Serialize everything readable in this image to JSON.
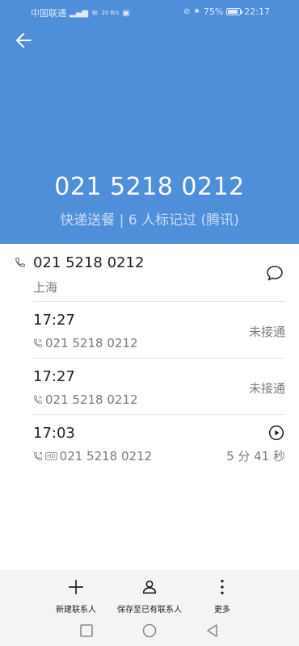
{
  "status_bar": {
    "carrier": "中国联通",
    "net_speed": "20 B/s",
    "battery": "75%",
    "time": "22:17"
  },
  "header": {
    "phone_number": "021 5218 0212",
    "tag_line": "快递送餐 | 6 人标记过 (腾讯)"
  },
  "contact": {
    "number": "021 5218 0212",
    "location": "上海"
  },
  "call_log": [
    {
      "time": "17:27",
      "number": "021 5218 0212",
      "status": "未接通"
    },
    {
      "time": "17:27",
      "number": "021 5218 0212",
      "status": "未接通"
    },
    {
      "time": "17:03",
      "number": "021 5218 0212",
      "hd": "HD",
      "duration": "5 分 41 秒"
    }
  ],
  "actions": {
    "new_contact": "新建联系人",
    "save_existing": "保存至已有联系人",
    "more": "更多"
  },
  "colors": {
    "header_bg": "#4f8fd9",
    "header_text": "#ffffff",
    "muted_text": "#7a7a7a"
  },
  "icons": [
    "back-arrow-icon",
    "phone-icon",
    "message-icon",
    "play-icon",
    "plus-icon",
    "person-icon",
    "more-vertical-icon"
  ]
}
